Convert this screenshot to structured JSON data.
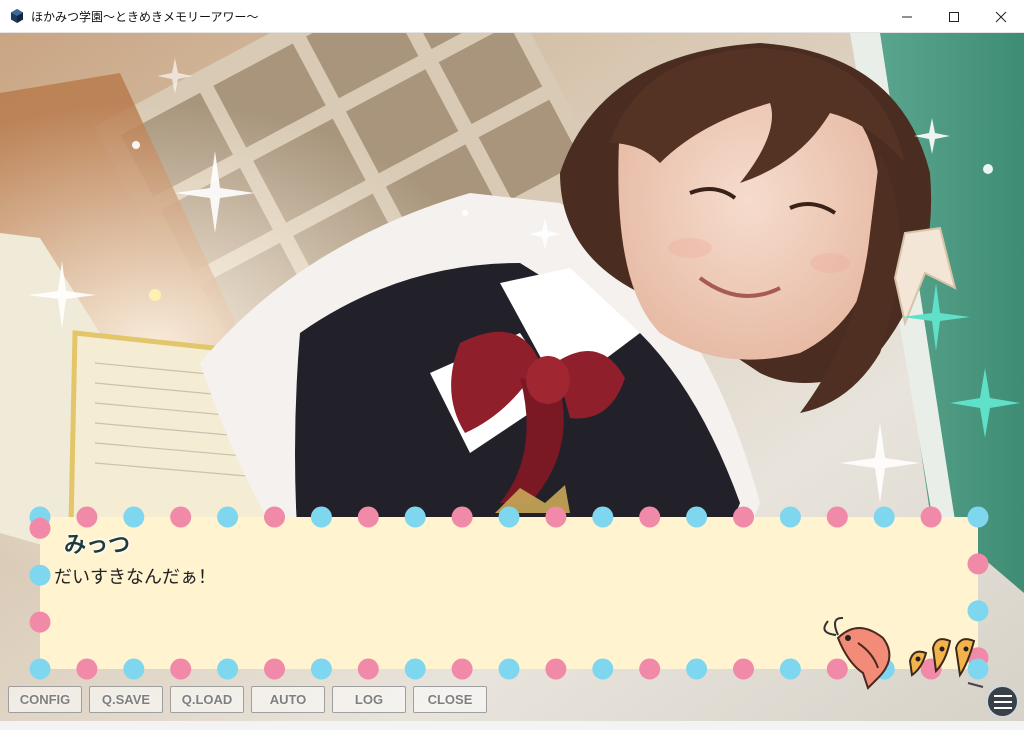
{
  "window": {
    "title": "ほかみつ学園〜ときめきメモリーアワー〜",
    "icon": "app-cube-icon",
    "controls": [
      "minimize-icon",
      "maximize-icon",
      "close-icon"
    ]
  },
  "dialogue": {
    "speaker": "みっつ",
    "text": "だいすきなんだぁ！"
  },
  "menu": {
    "buttons": [
      "CONFIG",
      "Q.SAVE",
      "Q.LOAD",
      "AUTO",
      "LOG",
      "CLOSE"
    ]
  },
  "menu_icon": "hamburger-menu-icon",
  "colors": {
    "message_box": "#fff3d0",
    "dot_pink": "#f08aa8",
    "dot_cyan": "#7fd6ef",
    "speaker_text": "#1f3a3a",
    "menu_button_text": "#787878"
  }
}
